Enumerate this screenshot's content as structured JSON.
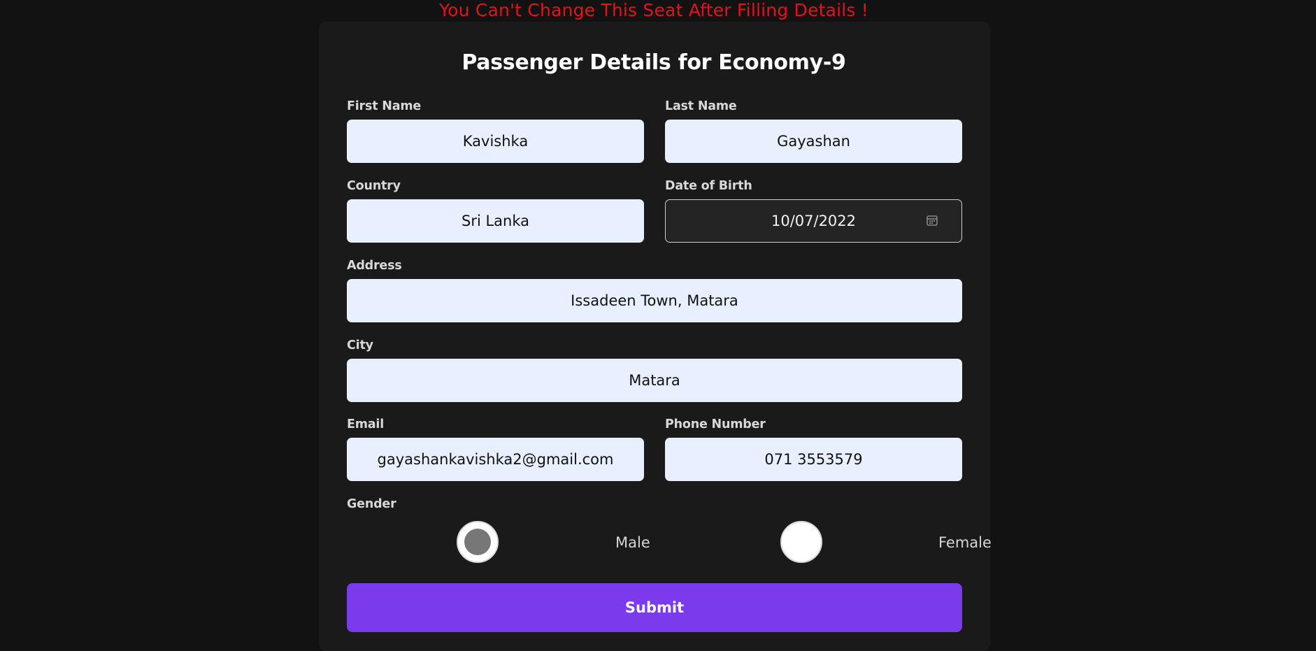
{
  "warning": "You Can't Change This Seat After Filling Details !",
  "form": {
    "title": "Passenger Details for Economy-9",
    "first_name": {
      "label": "First Name",
      "value": "Kavishka"
    },
    "last_name": {
      "label": "Last Name",
      "value": "Gayashan"
    },
    "country": {
      "label": "Country",
      "value": "Sri Lanka"
    },
    "dob": {
      "label": "Date of Birth",
      "value": "10/07/2022"
    },
    "address": {
      "label": "Address",
      "value": "Issadeen Town, Matara"
    },
    "city": {
      "label": "City",
      "value": "Matara"
    },
    "email": {
      "label": "Email",
      "value": "gayashankavishka2@gmail.com"
    },
    "phone": {
      "label": "Phone Number",
      "value": "071 3553579"
    },
    "gender": {
      "label": "Gender",
      "options": [
        {
          "label": "Male",
          "checked": true
        },
        {
          "label": "Female",
          "checked": false
        }
      ]
    },
    "submit_label": "Submit"
  },
  "icons": {
    "date_picker": "calendar-icon"
  },
  "colors": {
    "background": "#121212",
    "card": "#1a1a1a",
    "warning": "#e8101a",
    "input": "#e8effe",
    "submit": "#7b3aec"
  }
}
